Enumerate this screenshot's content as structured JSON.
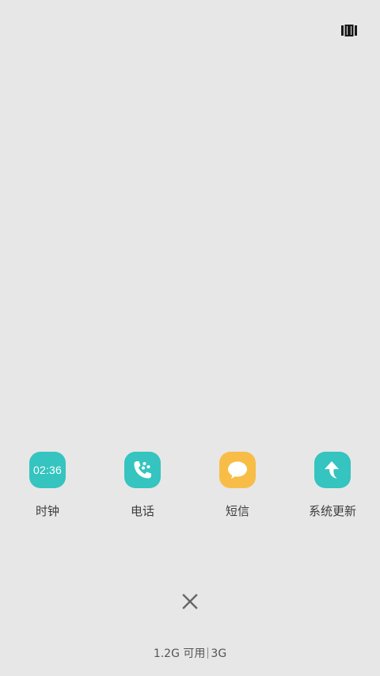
{
  "colors": {
    "background": "#e7e7e7",
    "teal": "#35c4bf",
    "amber": "#f7bd47",
    "label": "#3d3d3d",
    "close": "#666666"
  },
  "apps": [
    {
      "label": "时钟",
      "icon": "clock-icon",
      "time": "02:36",
      "color": "#35c4bf"
    },
    {
      "label": "电话",
      "icon": "phone-icon",
      "color": "#35c4bf"
    },
    {
      "label": "短信",
      "icon": "message-icon",
      "color": "#f7bd47"
    },
    {
      "label": "系统更新",
      "icon": "system-update-icon",
      "color": "#35c4bf"
    }
  ],
  "memory": {
    "available": "1.2G 可用",
    "total": "3G"
  }
}
